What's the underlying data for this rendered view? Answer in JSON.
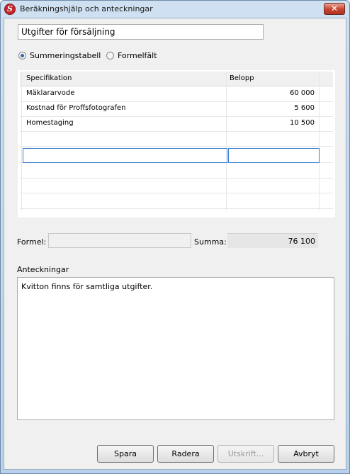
{
  "window": {
    "title": "Beräkningshjälp och anteckningar",
    "close_glyph": "✕"
  },
  "header": {
    "name_value": "Utgifter för försäljning"
  },
  "mode": {
    "option_table": "Summeringstabell",
    "option_formula": "Formelfält",
    "selected": "Summeringstabell"
  },
  "table": {
    "columns": [
      "Specifikation",
      "Belopp"
    ],
    "rows": [
      {
        "spec": "Mäklararvode",
        "amount": "60 000"
      },
      {
        "spec": "Kostnad för Proffsfotografen",
        "amount": "5 600"
      },
      {
        "spec": "Homestaging",
        "amount": "10 500"
      }
    ]
  },
  "totals": {
    "formula_label": "Formel:",
    "formula_value": "",
    "sum_label": "Summa:",
    "sum_value": "76 100"
  },
  "notes": {
    "label": "Anteckningar",
    "text": "Kvitton finns för samtliga utgifter."
  },
  "buttons": {
    "save": "Spara",
    "delete": "Radera",
    "print": "Utskrift...",
    "cancel": "Avbryt"
  },
  "icons": {
    "app": "app-logo-icon",
    "close": "close-icon"
  }
}
